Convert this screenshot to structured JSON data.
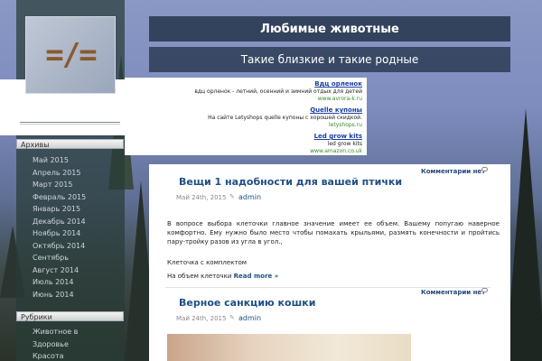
{
  "header": {
    "site_title": "Любимые животные",
    "site_description": "Такие близкие и такие родные",
    "logo_icon": "not-equal-logo"
  },
  "ads": [
    {
      "title": "Вдц орленок",
      "text": "вдц орленок - летний, осенний и зимний отдых для детей",
      "url": "www.avrora-k.ru"
    },
    {
      "title": "Quelle купоны",
      "text": "На сайте Letyshops quelle купоны с хорошей скидкой.",
      "url": "letyshops.ru"
    },
    {
      "title": "Led grow kits",
      "text": "led grow kits",
      "url": "www.amazon.co.uk"
    }
  ],
  "sidebar": {
    "archives_title": "Архивы",
    "archives": [
      "Май 2015",
      "Апрель 2015",
      "Март 2015",
      "Февраль 2015",
      "Январь 2015",
      "Декабрь 2014",
      "Ноябрь 2014",
      "Октябрь 2014",
      "Сентябрь",
      "Август 2014",
      "Июль 2014",
      "Июнь 2014"
    ],
    "categories_title": "Рубрики",
    "categories": [
      "Животное в",
      "Здоровье",
      "Красота"
    ]
  },
  "posts": [
    {
      "comments": "Комментарии нет",
      "title": "Вещи 1 надобности для вашей птички",
      "date": "Май 24th, 2015",
      "author": "admin",
      "body": "В вопросе выбора клеточки главное значение имеет ее объем. Вашему попугаю наверное комфортно. Ему нужно было место чтобы помахать крыльями, размять конечности и пройтись пару-тройку разов из угла в угол.,",
      "body2": "Клеточка с комплектом",
      "teaser": "На объем клеточки",
      "read_more": "Read more »"
    },
    {
      "comments": "Комментарии нет",
      "title": "Верное санкцию кошки",
      "date": "Май 24th, 2015",
      "author": "admin"
    }
  ]
}
